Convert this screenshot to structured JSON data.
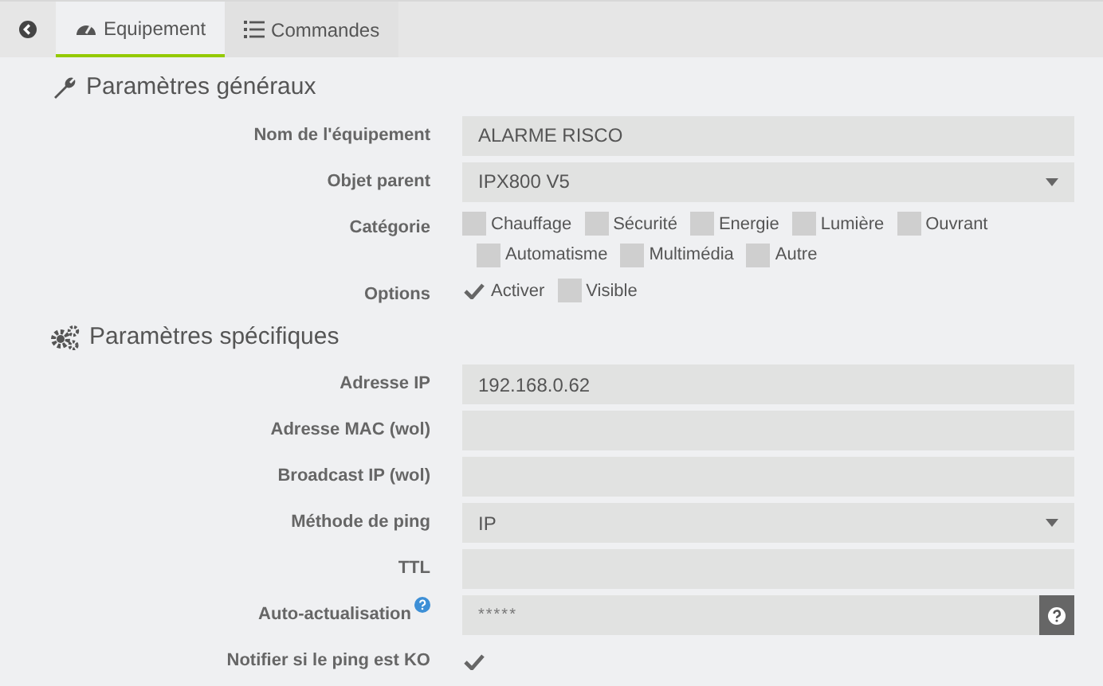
{
  "tabs": [
    {
      "label": "Equipement",
      "selected": true
    },
    {
      "label": "Commandes",
      "selected": false
    }
  ],
  "sections": [
    {
      "title": "Paramètres généraux",
      "rows": [
        {
          "kind": "text",
          "label": "Nom de l'équipement",
          "value": "ALARME RISCO"
        },
        {
          "kind": "select",
          "label": "Objet parent",
          "value": "IPX800 V5"
        },
        {
          "kind": "checkboxes",
          "label": "Catégorie",
          "lines": [
            [
              {
                "label": "Chauffage",
                "checked": false
              },
              {
                "label": "Sécurité",
                "checked": false
              },
              {
                "label": "Energie",
                "checked": false
              },
              {
                "label": "Lumière",
                "checked": false
              },
              {
                "label": "Ouvrant",
                "checked": false
              }
            ],
            [
              {
                "label": "Automatisme",
                "checked": false
              },
              {
                "label": "Multimédia",
                "checked": false
              },
              {
                "label": "Autre",
                "checked": false
              }
            ]
          ]
        },
        {
          "kind": "checkboxes",
          "label": "Options",
          "lines": [
            [
              {
                "label": "Activer",
                "checked": true
              },
              {
                "label": "Visible",
                "checked": false
              }
            ]
          ]
        }
      ]
    },
    {
      "title": "Paramètres spécifiques",
      "rows": [
        {
          "kind": "text",
          "label": "Adresse IP",
          "value": "192.168.0.62"
        },
        {
          "kind": "text",
          "label": "Adresse MAC (wol)"
        },
        {
          "kind": "text",
          "label": "Broadcast IP (wol)"
        },
        {
          "kind": "select",
          "label": "Méthode de ping",
          "value": "IP"
        },
        {
          "kind": "text",
          "label": "TTL"
        },
        {
          "kind": "password",
          "label": "Auto-actualisation",
          "help": true,
          "value": "*****"
        },
        {
          "kind": "checkbox",
          "label": "Notifier si le ping est KO",
          "checked": true
        }
      ]
    }
  ]
}
